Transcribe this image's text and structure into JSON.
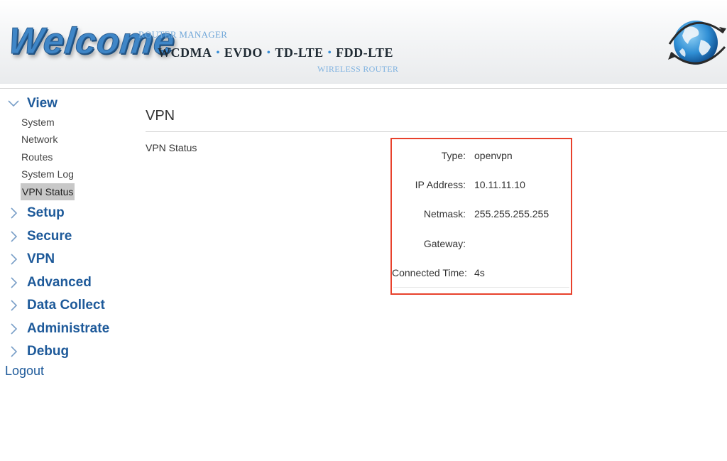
{
  "header": {
    "welcome": "Welcome",
    "router_manager": "ROUTER MANAGER",
    "tech": [
      "WCDMA",
      "EVDO",
      "TD-LTE",
      "FDD-LTE"
    ],
    "wireless_router": "WIRELESS ROUTER",
    "globe_icon": "globe-icon"
  },
  "sidebar": {
    "view": {
      "label": "View",
      "expanded": true,
      "items": [
        "System",
        "Network",
        "Routes",
        "System Log",
        "VPN Status"
      ],
      "active": "VPN Status"
    },
    "groups": [
      "Setup",
      "Secure",
      "VPN",
      "Advanced",
      "Data Collect",
      "Administrate",
      "Debug"
    ],
    "logout": "Logout"
  },
  "main": {
    "title": "VPN",
    "section_label": "VPN Status",
    "status": {
      "rows": [
        {
          "key": "Type:",
          "value": "openvpn"
        },
        {
          "key": "IP Address:",
          "value": "10.11.11.10"
        },
        {
          "key": "Netmask:",
          "value": "255.255.255.255"
        },
        {
          "key": "Gateway:",
          "value": ""
        },
        {
          "key": "Connected Time:",
          "value": "4s"
        }
      ]
    }
  },
  "colors": {
    "accent": "#1e5a9a",
    "highlight_box": "#e8412c",
    "active_item_bg": "#c8c8c8"
  }
}
